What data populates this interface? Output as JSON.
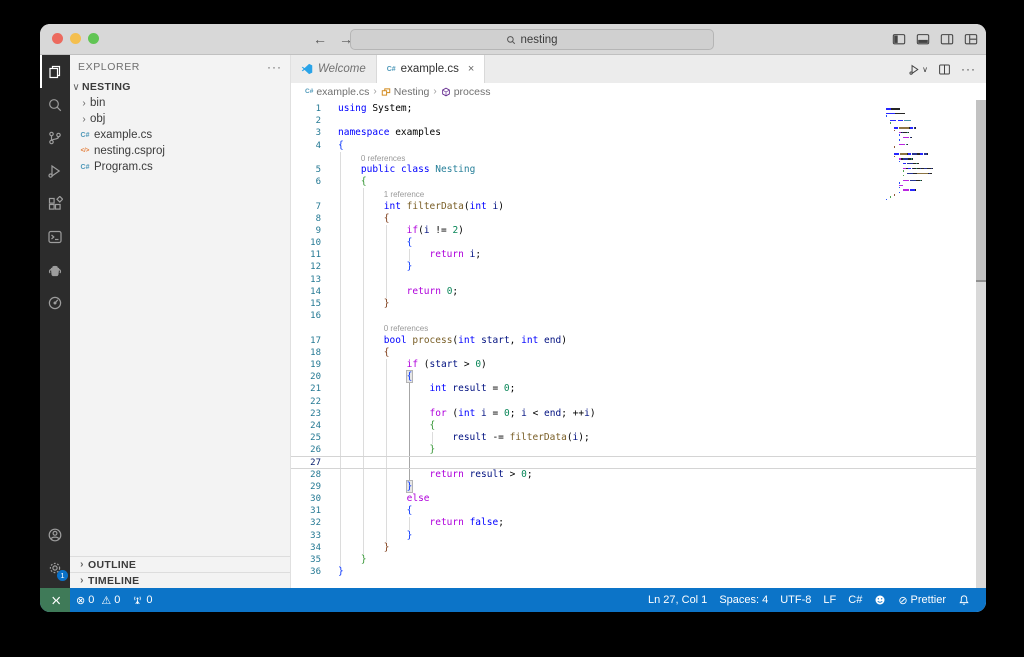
{
  "colors": {
    "status_bar_bg": "#0c74c8",
    "remote_bg": "#3f7a58",
    "traffic": [
      "#ec6a5e",
      "#f4bf4f",
      "#61c554"
    ],
    "csharp_icon": "#519aba",
    "csproj_icon": "#e37933",
    "class_icon": "#d18616",
    "method_icon": "#652d90",
    "vscode_logo": "#29a3e8",
    "syntax": {
      "k": "#0000ff",
      "c": "#af00db",
      "t": "#267f99",
      "f": "#795e26",
      "v": "#001080",
      "n": "#098658",
      "p": "#000000",
      "b1": "#0431fa",
      "b2": "#319331",
      "b3": "#7b3814"
    }
  },
  "titlebar": {
    "search_value": "nesting",
    "back_arrow": "←",
    "forward_arrow": "→"
  },
  "activity_bar": {
    "top": [
      {
        "name": "explorer",
        "active": true
      },
      {
        "name": "search",
        "active": false
      },
      {
        "name": "source-control",
        "active": false
      },
      {
        "name": "run-debug",
        "active": false
      },
      {
        "name": "extensions",
        "active": false
      },
      {
        "name": "terminal",
        "active": false
      },
      {
        "name": "teapot",
        "active": false
      },
      {
        "name": "gauge",
        "active": false
      }
    ],
    "bottom": [
      {
        "name": "account",
        "active": false
      },
      {
        "name": "settings",
        "active": false,
        "badge": "1"
      }
    ]
  },
  "sidebar": {
    "title": "EXPLORER",
    "more_label": "···",
    "section": "NESTING",
    "items": [
      {
        "label": "bin",
        "kind": "folder"
      },
      {
        "label": "obj",
        "kind": "folder"
      },
      {
        "label": "example.cs",
        "kind": "csharp"
      },
      {
        "label": "nesting.csproj",
        "kind": "csproj"
      },
      {
        "label": "Program.cs",
        "kind": "csharp"
      }
    ],
    "panels": [
      "OUTLINE",
      "TIMELINE"
    ]
  },
  "tabs": [
    {
      "label": "Welcome",
      "icon": "vscode",
      "active": false,
      "preview": true,
      "close": ""
    },
    {
      "label": "example.cs",
      "icon": "csharp",
      "active": true,
      "preview": false,
      "close": "×"
    }
  ],
  "breadcrumb": [
    {
      "label": "example.cs",
      "icon": "csharp-file"
    },
    {
      "label": "Nesting",
      "icon": "symbol-class"
    },
    {
      "label": "process",
      "icon": "symbol-method"
    }
  ],
  "editor": {
    "lines": [
      {
        "n": 1,
        "indent": 0,
        "g": 0,
        "ag": -1,
        "tokens": [
          [
            "using",
            "k"
          ],
          [
            " System;",
            "p"
          ]
        ]
      },
      {
        "n": 2,
        "indent": 0,
        "g": 0,
        "ag": -1,
        "tokens": []
      },
      {
        "n": 3,
        "indent": 0,
        "g": 0,
        "ag": -1,
        "tokens": [
          [
            "namespace",
            "k"
          ],
          [
            " examples",
            "p"
          ]
        ]
      },
      {
        "n": 4,
        "indent": 0,
        "g": 0,
        "ag": -1,
        "tokens": [
          [
            "{",
            "b1"
          ]
        ]
      },
      {
        "n": 5,
        "indent": 4,
        "g": 1,
        "ag": -1,
        "lens": "0 references",
        "tokens": [
          [
            "public",
            "k"
          ],
          [
            " ",
            "p"
          ],
          [
            "class",
            "k"
          ],
          [
            " ",
            "p"
          ],
          [
            "Nesting",
            "t"
          ]
        ]
      },
      {
        "n": 6,
        "indent": 4,
        "g": 1,
        "ag": -1,
        "tokens": [
          [
            "{",
            "b2"
          ]
        ]
      },
      {
        "n": 7,
        "indent": 8,
        "g": 2,
        "ag": -1,
        "lens": "1 reference",
        "tokens": [
          [
            "int",
            "k"
          ],
          [
            " ",
            "p"
          ],
          [
            "filterData",
            "f"
          ],
          [
            "(",
            "p"
          ],
          [
            "int",
            "k"
          ],
          [
            " ",
            "p"
          ],
          [
            "i",
            "v"
          ],
          [
            ")",
            "p"
          ]
        ]
      },
      {
        "n": 8,
        "indent": 8,
        "g": 2,
        "ag": -1,
        "tokens": [
          [
            "{",
            "b3"
          ]
        ]
      },
      {
        "n": 9,
        "indent": 12,
        "g": 3,
        "ag": -1,
        "tokens": [
          [
            "if",
            "c"
          ],
          [
            "(",
            "p"
          ],
          [
            "i",
            "v"
          ],
          [
            " != ",
            "p"
          ],
          [
            "2",
            "n"
          ],
          [
            ")",
            "p"
          ]
        ]
      },
      {
        "n": 10,
        "indent": 12,
        "g": 3,
        "ag": -1,
        "tokens": [
          [
            "{",
            "b1"
          ]
        ]
      },
      {
        "n": 11,
        "indent": 16,
        "g": 4,
        "ag": -1,
        "tokens": [
          [
            "return",
            "c"
          ],
          [
            " ",
            "p"
          ],
          [
            "i",
            "v"
          ],
          [
            ";",
            "p"
          ]
        ]
      },
      {
        "n": 12,
        "indent": 12,
        "g": 3,
        "ag": -1,
        "tokens": [
          [
            "}",
            "b1"
          ]
        ]
      },
      {
        "n": 13,
        "indent": 12,
        "g": 3,
        "ag": -1,
        "tokens": []
      },
      {
        "n": 14,
        "indent": 12,
        "g": 3,
        "ag": -1,
        "tokens": [
          [
            "return",
            "c"
          ],
          [
            " ",
            "p"
          ],
          [
            "0",
            "n"
          ],
          [
            ";",
            "p"
          ]
        ]
      },
      {
        "n": 15,
        "indent": 8,
        "g": 2,
        "ag": -1,
        "tokens": [
          [
            "}",
            "b3"
          ]
        ]
      },
      {
        "n": 16,
        "indent": 8,
        "g": 2,
        "ag": -1,
        "tokens": []
      },
      {
        "n": 17,
        "indent": 8,
        "g": 2,
        "ag": -1,
        "lens": "0 references",
        "tokens": [
          [
            "bool",
            "k"
          ],
          [
            " ",
            "p"
          ],
          [
            "process",
            "f"
          ],
          [
            "(",
            "p"
          ],
          [
            "int",
            "k"
          ],
          [
            " ",
            "p"
          ],
          [
            "start",
            "v"
          ],
          [
            ", ",
            "p"
          ],
          [
            "int",
            "k"
          ],
          [
            " ",
            "p"
          ],
          [
            "end",
            "v"
          ],
          [
            ")",
            "p"
          ]
        ]
      },
      {
        "n": 18,
        "indent": 8,
        "g": 2,
        "ag": -1,
        "tokens": [
          [
            "{",
            "b3"
          ]
        ]
      },
      {
        "n": 19,
        "indent": 12,
        "g": 3,
        "ag": -1,
        "tokens": [
          [
            "if",
            "c"
          ],
          [
            " (",
            "p"
          ],
          [
            "start",
            "v"
          ],
          [
            " > ",
            "p"
          ],
          [
            "0",
            "n"
          ],
          [
            ")",
            "p"
          ]
        ]
      },
      {
        "n": 20,
        "indent": 12,
        "g": 3,
        "ag": -1,
        "tokens": [
          [
            "{",
            "b1",
            "m"
          ]
        ]
      },
      {
        "n": 21,
        "indent": 16,
        "g": 4,
        "ag": 3,
        "tokens": [
          [
            "int",
            "k"
          ],
          [
            " ",
            "p"
          ],
          [
            "result",
            "v"
          ],
          [
            " = ",
            "p"
          ],
          [
            "0",
            "n"
          ],
          [
            ";",
            "p"
          ]
        ]
      },
      {
        "n": 22,
        "indent": 16,
        "g": 4,
        "ag": 3,
        "tokens": []
      },
      {
        "n": 23,
        "indent": 16,
        "g": 4,
        "ag": 3,
        "tokens": [
          [
            "for",
            "c"
          ],
          [
            " (",
            "p"
          ],
          [
            "int",
            "k"
          ],
          [
            " ",
            "p"
          ],
          [
            "i",
            "v"
          ],
          [
            " = ",
            "p"
          ],
          [
            "0",
            "n"
          ],
          [
            "; ",
            "p"
          ],
          [
            "i",
            "v"
          ],
          [
            " < ",
            "p"
          ],
          [
            "end",
            "v"
          ],
          [
            "; ++",
            "p"
          ],
          [
            "i",
            "v"
          ],
          [
            ")",
            "p"
          ]
        ]
      },
      {
        "n": 24,
        "indent": 16,
        "g": 4,
        "ag": 3,
        "tokens": [
          [
            "{",
            "b2"
          ]
        ]
      },
      {
        "n": 25,
        "indent": 20,
        "g": 5,
        "ag": 3,
        "tokens": [
          [
            "result",
            "v"
          ],
          [
            " -= ",
            "p"
          ],
          [
            "filterData",
            "f"
          ],
          [
            "(",
            "p"
          ],
          [
            "i",
            "v"
          ],
          [
            ");",
            "p"
          ]
        ]
      },
      {
        "n": 26,
        "indent": 16,
        "g": 4,
        "ag": 3,
        "tokens": [
          [
            "}",
            "b2"
          ]
        ]
      },
      {
        "n": 27,
        "indent": 16,
        "g": 4,
        "ag": 3,
        "cursor": true,
        "tokens": []
      },
      {
        "n": 28,
        "indent": 16,
        "g": 4,
        "ag": 3,
        "tokens": [
          [
            "return",
            "c"
          ],
          [
            " ",
            "p"
          ],
          [
            "result",
            "v"
          ],
          [
            " > ",
            "p"
          ],
          [
            "0",
            "n"
          ],
          [
            ";",
            "p"
          ]
        ]
      },
      {
        "n": 29,
        "indent": 12,
        "g": 3,
        "ag": -1,
        "tokens": [
          [
            "}",
            "b1",
            "m"
          ]
        ]
      },
      {
        "n": 30,
        "indent": 12,
        "g": 3,
        "ag": -1,
        "tokens": [
          [
            "else",
            "c"
          ]
        ]
      },
      {
        "n": 31,
        "indent": 12,
        "g": 3,
        "ag": -1,
        "tokens": [
          [
            "{",
            "b1"
          ]
        ]
      },
      {
        "n": 32,
        "indent": 16,
        "g": 4,
        "ag": -1,
        "tokens": [
          [
            "return",
            "c"
          ],
          [
            " ",
            "p"
          ],
          [
            "false",
            "k"
          ],
          [
            ";",
            "p"
          ]
        ]
      },
      {
        "n": 33,
        "indent": 12,
        "g": 3,
        "ag": -1,
        "tokens": [
          [
            "}",
            "b1"
          ]
        ]
      },
      {
        "n": 34,
        "indent": 8,
        "g": 2,
        "ag": -1,
        "tokens": [
          [
            "}",
            "b3"
          ]
        ]
      },
      {
        "n": 35,
        "indent": 4,
        "g": 1,
        "ag": -1,
        "tokens": [
          [
            "}",
            "b2"
          ]
        ]
      },
      {
        "n": 36,
        "indent": 0,
        "g": 0,
        "ag": -1,
        "tokens": [
          [
            "}",
            "b1"
          ]
        ]
      }
    ]
  },
  "status_bar": {
    "errors": "0",
    "warnings": "0",
    "ports": "0",
    "line_col": "Ln 27, Col 1",
    "spaces": "Spaces: 4",
    "encoding": "UTF-8",
    "eol": "LF",
    "language": "C#",
    "formatter": "Prettier",
    "error_icon": "⊗",
    "warning_icon": "⚠",
    "formatter_icon": "⊘"
  }
}
